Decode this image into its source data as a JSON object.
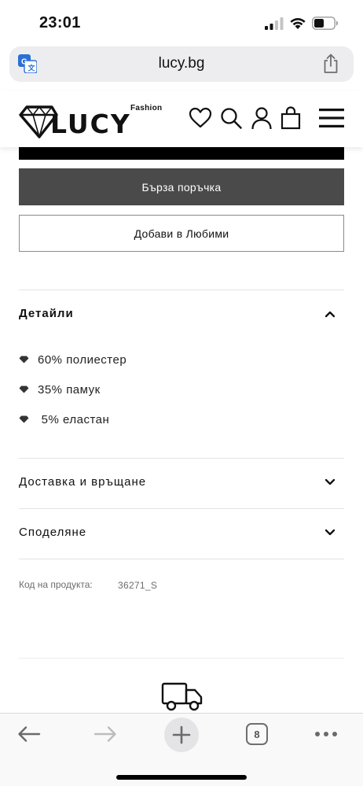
{
  "status_bar": {
    "time": "23:01"
  },
  "browser": {
    "url": "lucy.bg",
    "tab_count": "8",
    "icons": [
      "translate-icon",
      "share-icon",
      "back-icon",
      "forward-icon",
      "plus-icon",
      "tabs-icon",
      "more-icon"
    ]
  },
  "header": {
    "logo_small": "Fashion",
    "logo_word": "LUCY",
    "icons": [
      "heart-icon",
      "search-icon",
      "user-icon",
      "bag-icon",
      "menu-icon"
    ]
  },
  "product": {
    "quick_order_label": "Бърза поръчка",
    "add_favorites_label": "Добави в Любими"
  },
  "details": {
    "title": "Детайли",
    "items": [
      {
        "text": "60% полиестер"
      },
      {
        "text": "35% памук"
      },
      {
        "text": " 5% еластан"
      }
    ]
  },
  "delivery": {
    "title": "Доставка и връщане"
  },
  "share": {
    "title": "Споделяне"
  },
  "product_code": {
    "label": "Код на продукта:",
    "value": "36271_S"
  },
  "colors": {
    "quick_order_bg": "#4a4a4a",
    "url_bar_bg": "#ededf0",
    "divider": "#e3e3e3"
  }
}
